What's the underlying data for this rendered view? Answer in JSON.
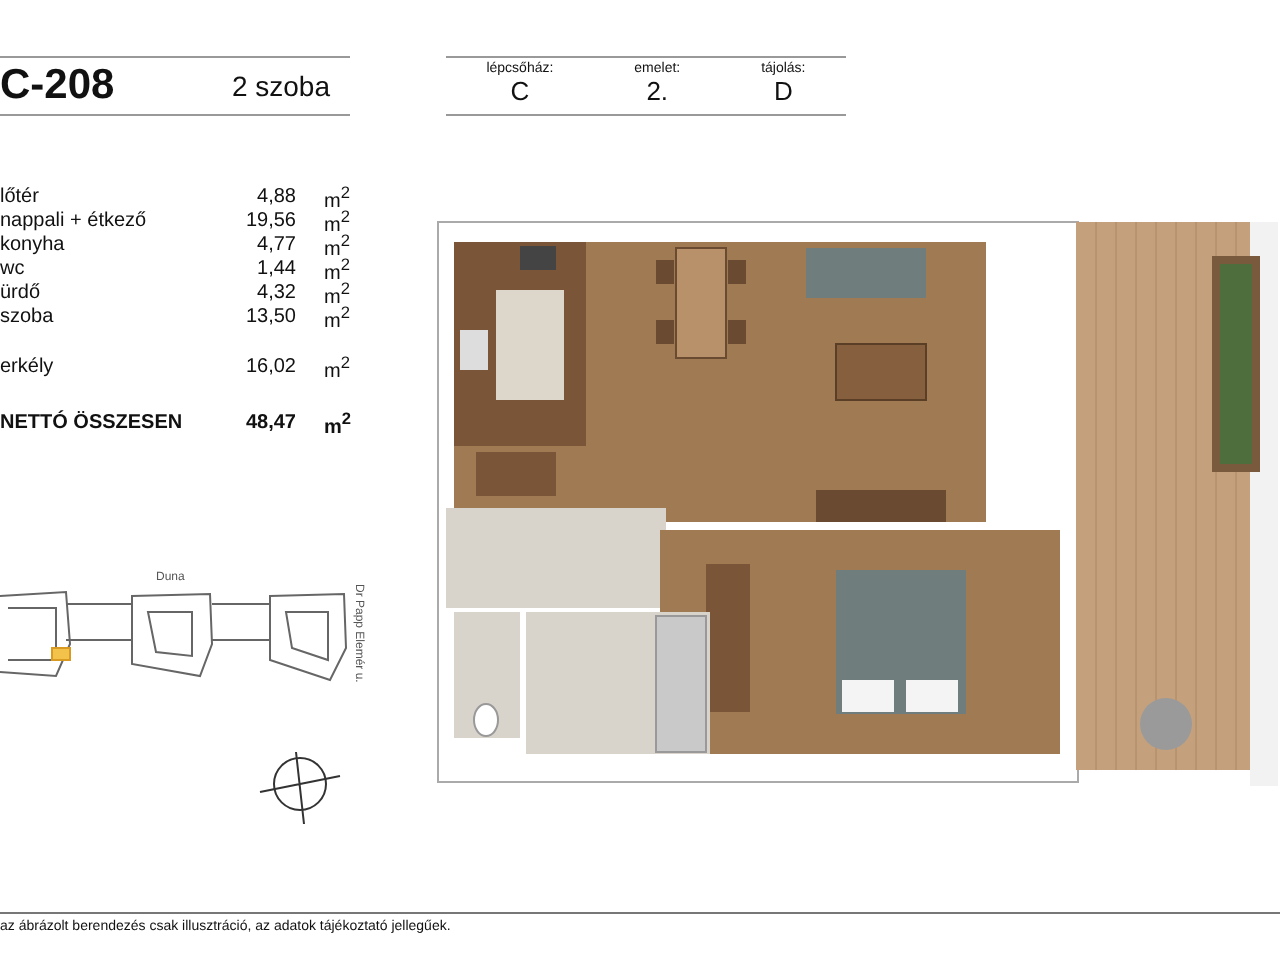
{
  "header": {
    "unit": "C-208",
    "rooms": "2 szoba",
    "fields": [
      {
        "label": "lépcsőház:",
        "value": "C"
      },
      {
        "label": "emelet:",
        "value": "2."
      },
      {
        "label": "tájolás:",
        "value": "D"
      }
    ]
  },
  "areas": [
    {
      "name": "lőtér",
      "value": "4,88",
      "unit": "m$^{2}$",
      "kind": "room"
    },
    {
      "name": "nappali + étkező",
      "value": "19,56",
      "unit": "m$^{2}$",
      "kind": "room"
    },
    {
      "name": "konyha",
      "value": "4,77",
      "unit": "m$^{2}$",
      "kind": "room"
    },
    {
      "name": "wc",
      "value": "1,44",
      "unit": "m$^{2}$",
      "kind": "room"
    },
    {
      "name": "ürdő",
      "value": "4,32",
      "unit": "m$^{2}$",
      "kind": "room"
    },
    {
      "name": "szoba",
      "value": "13,50",
      "unit": "m$^{2}$",
      "kind": "room"
    },
    {
      "name": "erkély",
      "value": "16,02",
      "unit": "m$^{2}$",
      "kind": "balcony"
    },
    {
      "name": "NETTÓ ÖSSZESEN",
      "value": "48,47",
      "unit": "m$^{2}$",
      "kind": "total"
    }
  ],
  "site_map": {
    "labels": [
      {
        "text": "Duna",
        "kind": "horizontal"
      },
      {
        "text": "Dr Papp Elemér u.",
        "kind": "vertical"
      }
    ]
  },
  "footer": "az ábrázolt berendezés csak illusztráció, az adatok tájékoztató jellegűek."
}
